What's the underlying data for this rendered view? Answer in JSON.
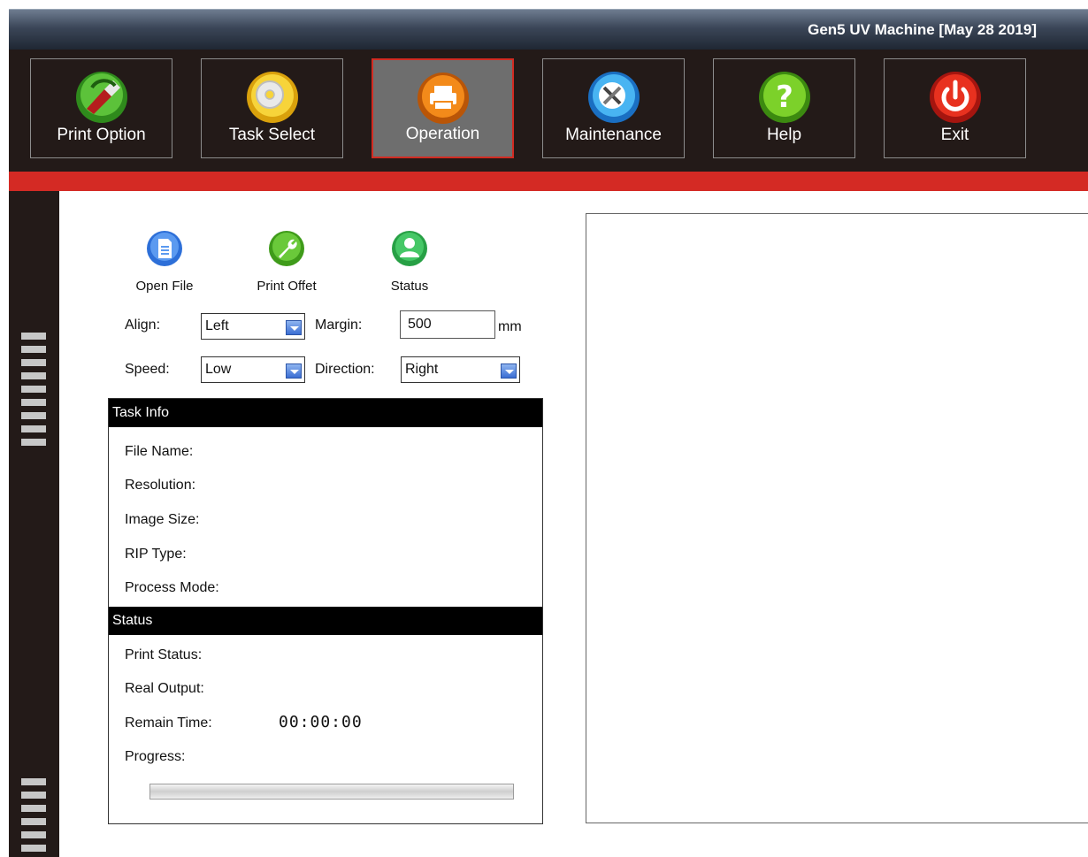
{
  "window": {
    "title": "Gen5 UV Machine [May 28 2019]"
  },
  "toolbar": {
    "items": [
      {
        "label": "Print Option",
        "icon": "print-option-icon",
        "color": "#4caf2a",
        "active": false
      },
      {
        "label": "Task Select",
        "icon": "disc-icon",
        "color": "#f2c31a",
        "active": false
      },
      {
        "label": "Operation",
        "icon": "printer-icon",
        "color": "#f07a12",
        "active": true
      },
      {
        "label": "Maintenance",
        "icon": "tools-icon",
        "color": "#2c9be8",
        "active": false
      },
      {
        "label": "Help",
        "icon": "help-icon",
        "color": "#6cc21e",
        "active": false
      },
      {
        "label": "Exit",
        "icon": "power-icon",
        "color": "#e0241c",
        "active": false
      }
    ]
  },
  "actions": {
    "open_file": "Open File",
    "print_offset": "Print Offet",
    "status": "Status"
  },
  "settings": {
    "align_label": "Align:",
    "align_value": "Left",
    "margin_label": "Margin:",
    "margin_value": "500",
    "margin_unit": "mm",
    "speed_label": "Speed:",
    "speed_value": "Low",
    "direction_label": "Direction:",
    "direction_value": "Right"
  },
  "task_info": {
    "header": "Task Info",
    "file_name": "File Name:",
    "resolution": "Resolution:",
    "image_size": "Image Size:",
    "rip_type": "RIP Type:",
    "process_mode": "Process Mode:"
  },
  "status": {
    "header": "Status",
    "print_status": "Print Status:",
    "real_output": "Real Output:",
    "remain_time_label": "Remain Time:",
    "remain_time_value": "00:00:00",
    "progress_label": "Progress:",
    "progress_fraction": 0
  },
  "colors": {
    "accent_red": "#d42a24",
    "toolbar_bg": "#231a18"
  }
}
